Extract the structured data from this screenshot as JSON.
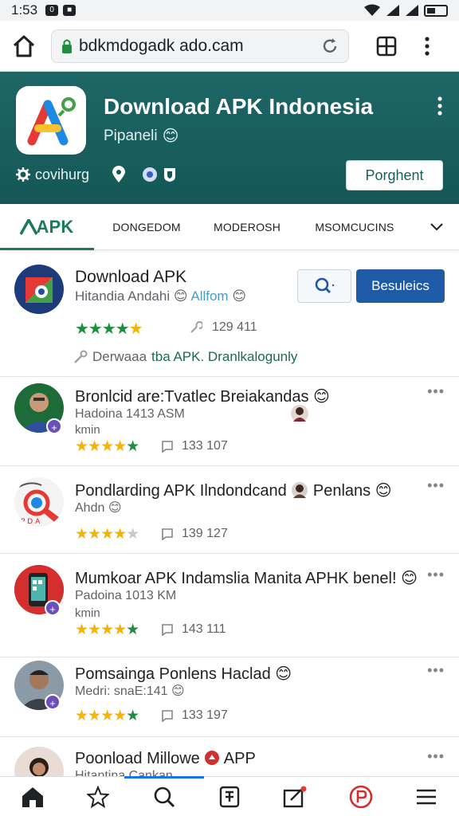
{
  "status_bar": {
    "time": "1:53",
    "badges": [
      "0",
      "■"
    ]
  },
  "browser": {
    "url": "bdkmdogadk ado.cam"
  },
  "header": {
    "title": "Download APK Indonesia",
    "subtitle": "Pipaneli",
    "meta_label": "covihurg",
    "action_button": "Porghent",
    "accent_color": "#1a5e5e"
  },
  "tabs": [
    {
      "label": "APK"
    },
    {
      "label": "DONGEDOM"
    },
    {
      "label": "MODEROSH"
    },
    {
      "label": "MSOMCUCINS"
    }
  ],
  "featured": {
    "title": "Download APK",
    "subtitle_text": "Hitandia Andahi",
    "subtitle_link": "Allfom",
    "button_label": "Besuleics",
    "rating": 4.5,
    "count": "129 411",
    "note_prefix": "Derwaaa",
    "note_link": "tba APK.  Dranlkalogunly"
  },
  "items": [
    {
      "title": "Bronlcid are:Tvatlec Breiakandas",
      "sub": "Hadoina 1413 ASM",
      "meta": "kmin",
      "rating": 4.5,
      "count": "133 107"
    },
    {
      "title": "Pondlarding APK Ilndondcand",
      "title_tail": "Penlans",
      "sub": "Ahdn",
      "meta": "",
      "rating": 3.5,
      "count": "139 127"
    },
    {
      "title": "Mumkoar APK Indamslia Manita APHK benel!",
      "sub": "Padoina 1013 KM",
      "meta": "kmin",
      "rating": 4.0,
      "count": "143 111"
    },
    {
      "title": "Pomsainga Ponlens Haclad",
      "sub": "Medri: snaE:141",
      "meta": "",
      "rating": 5.0,
      "count": "133 197"
    },
    {
      "title": "Poonload Millowe",
      "title_tail": "APP",
      "sub": "Hitantina Cankan",
      "meta": "",
      "rating": 0,
      "count": ""
    }
  ],
  "icons": {
    "home": "home-icon",
    "refresh": "refresh-icon",
    "tabs": "tabs-icon",
    "menu": "kebab-menu-icon",
    "search": "search-icon",
    "star": "star-icon",
    "grid": "grid-icon"
  }
}
